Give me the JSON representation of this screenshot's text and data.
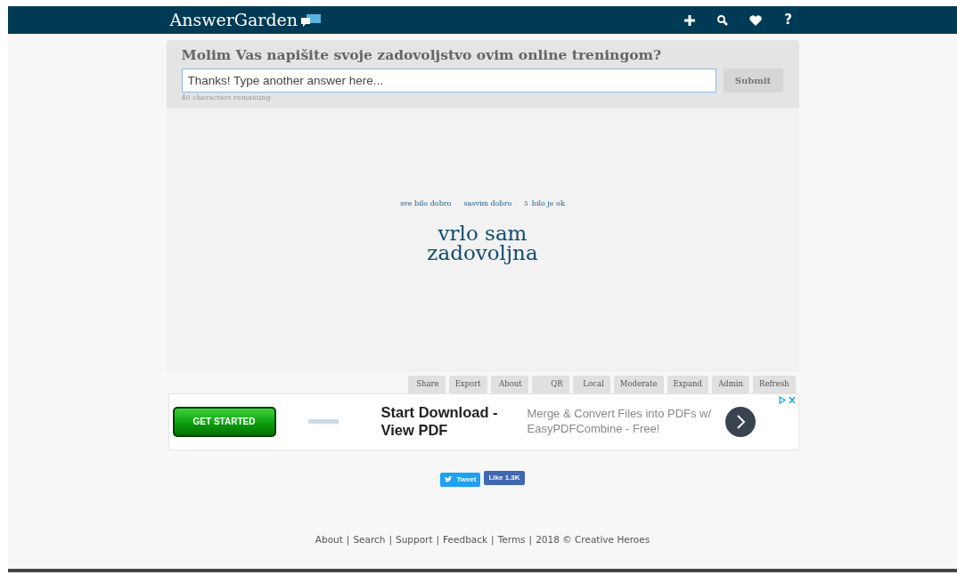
{
  "brand": {
    "title": "AnswerGarden"
  },
  "nav_icons": [
    {
      "kind": "plus"
    },
    {
      "kind": "search"
    },
    {
      "kind": "heart"
    },
    {
      "kind": "help",
      "label": "?"
    }
  ],
  "question": {
    "title": "Molim Vas napišite svoje zadovoljstvo ovim online treningom?",
    "placeholder": "Thanks! Type another answer here...",
    "submit": "Submit",
    "remaining": "40 characters remaining"
  },
  "answers": [
    {
      "text": "sve bilo dobro",
      "kind": "small"
    },
    {
      "text": "sasvim dobro",
      "kind": "small"
    },
    {
      "text": "bilo je ok",
      "count": "5",
      "kind": "small"
    },
    {
      "text": "vrlo sam zadovoljna",
      "kind": "large"
    }
  ],
  "tools": [
    "Share",
    "Export",
    "About",
    "QR",
    "Local",
    "Moderate",
    "Expand",
    "Admin",
    "Refresh"
  ],
  "ad": {
    "button": "GET STARTED",
    "headline": "Start Download - View PDF",
    "body": "Merge & Convert Files into PDFs w/ EasyPDFCombine - Free!"
  },
  "social": {
    "tweet": "Tweet",
    "like": "Like 1.3K"
  },
  "footer": {
    "separator": "|",
    "links": [
      "About",
      "Search",
      "Support",
      "Feedback",
      "Terms"
    ],
    "copyright": "2018 © Creative Heroes"
  }
}
